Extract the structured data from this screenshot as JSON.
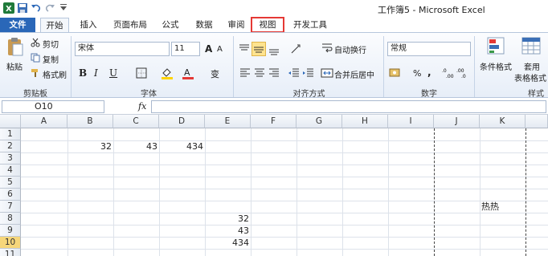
{
  "window": {
    "title": "工作簿5 - Microsoft Excel"
  },
  "tabs": [
    {
      "label": "文件"
    },
    {
      "label": "开始"
    },
    {
      "label": "插入"
    },
    {
      "label": "页面布局"
    },
    {
      "label": "公式"
    },
    {
      "label": "数据"
    },
    {
      "label": "审阅"
    },
    {
      "label": "视图"
    },
    {
      "label": "开发工具"
    }
  ],
  "clipboard": {
    "paste": "粘贴",
    "cut": "剪切",
    "copy": "复制",
    "format_painter": "格式刷",
    "group": "剪贴板"
  },
  "font": {
    "name": "宋体",
    "size": "11",
    "bold": "B",
    "italic": "I",
    "underline": "U",
    "grow": "A",
    "shrink": "A",
    "phonetic": "变",
    "group": "字体"
  },
  "alignment": {
    "wrap": "自动换行",
    "merge": "合并后居中",
    "group": "对齐方式"
  },
  "number": {
    "format": "常规",
    "percent": "%",
    "comma": ",",
    "group": "数字"
  },
  "styles": {
    "conditional": "条件格式",
    "table_line1": "套用",
    "table_line2": "表格格式",
    "group": "样式"
  },
  "formula_bar": {
    "name_box": "O10",
    "fx": "fx"
  },
  "columns": [
    "A",
    "B",
    "C",
    "D",
    "E",
    "F",
    "G",
    "H",
    "I",
    "J",
    "K"
  ],
  "rows": [
    "1",
    "2",
    "3",
    "4",
    "5",
    "6",
    "7",
    "8",
    "9",
    "10",
    "11"
  ],
  "cells": {
    "B2": "32",
    "C2": "43",
    "D2": "434",
    "K7": "热热",
    "E8": "32",
    "E9": "43",
    "E10": "434"
  },
  "colors": {
    "file_tab": "#2a67b8",
    "highlight_box": "#e53935",
    "selected_row_header": "#f6d67a"
  }
}
